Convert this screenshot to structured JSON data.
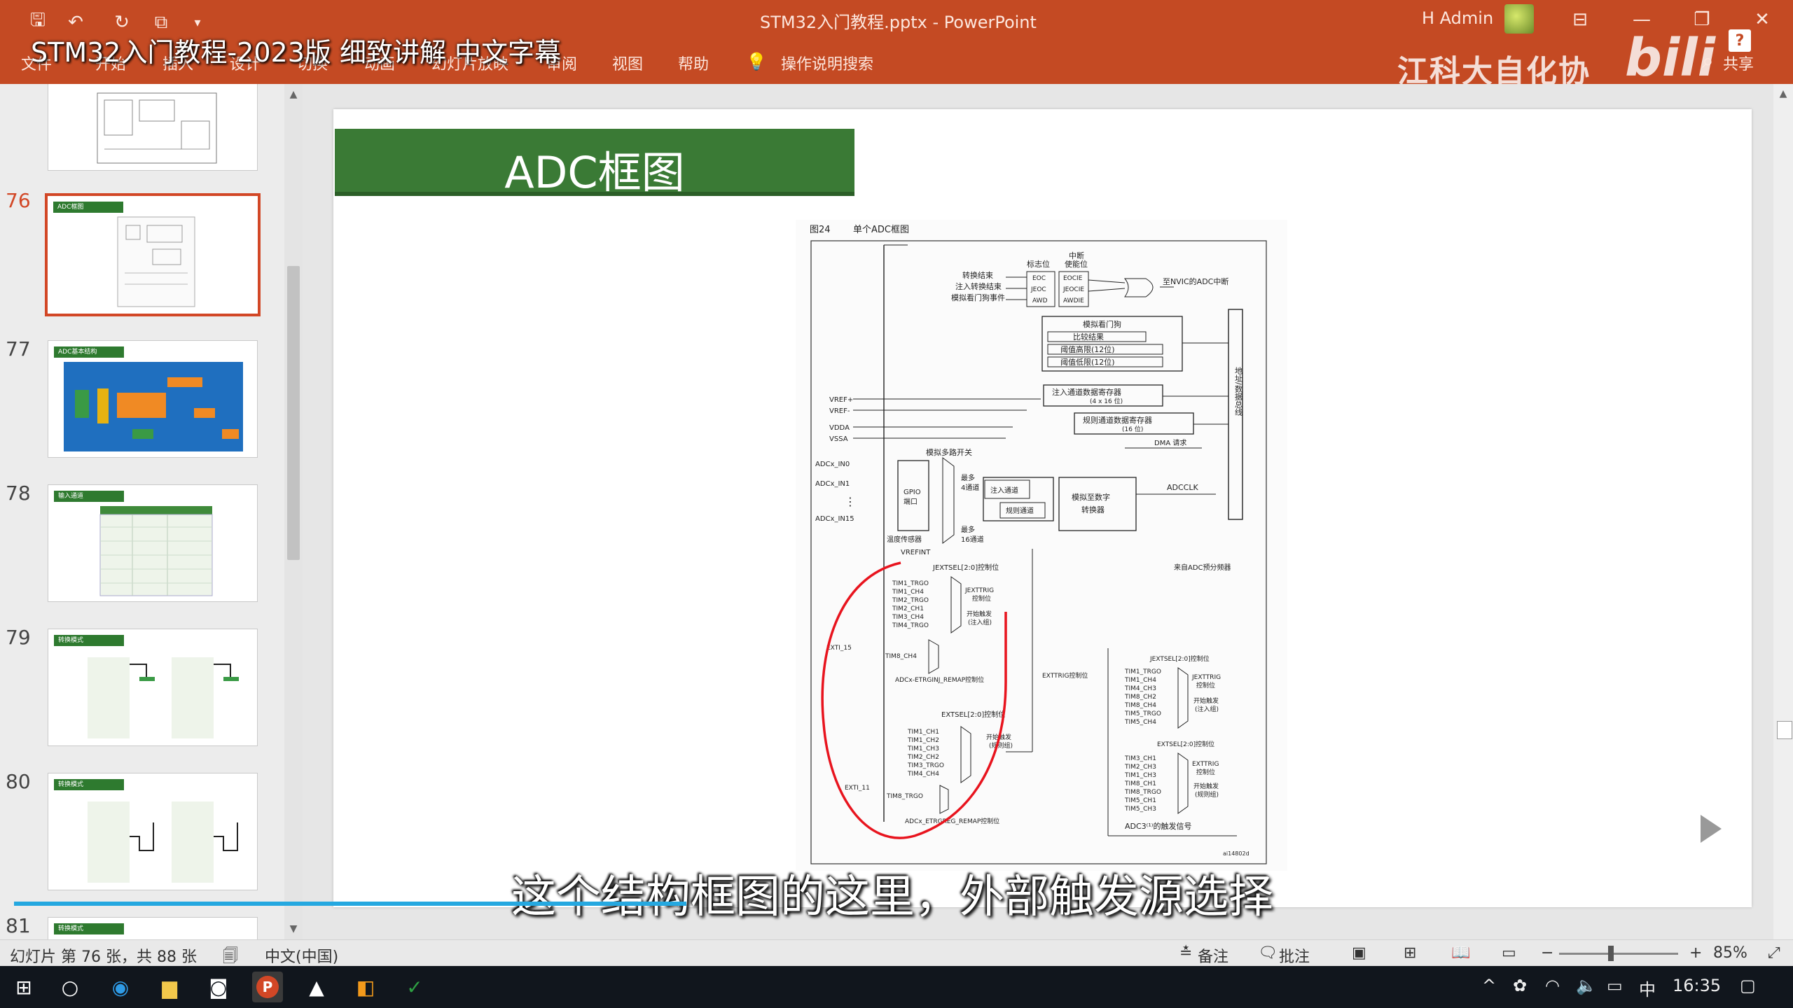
{
  "window": {
    "title": "STM32入门教程.pptx  -  PowerPoint",
    "user": "H Admin",
    "share_label": "共享"
  },
  "overlay_title": "STM32入门教程-2023版 细致讲解 中文字幕",
  "ribbon_tabs": [
    "文件",
    "开始",
    "插入",
    "设计",
    "切换",
    "动画",
    "幻灯片放映",
    "审阅",
    "视图",
    "帮助"
  ],
  "tell_me": "操作说明搜索",
  "watermark": {
    "text": "江科大自化协",
    "logo": "bilibili"
  },
  "thumbnails": [
    {
      "num": "",
      "title": ""
    },
    {
      "num": "76",
      "title": "ADC框图",
      "selected": true
    },
    {
      "num": "77",
      "title": "ADC基本结构"
    },
    {
      "num": "78",
      "title": "输入通道"
    },
    {
      "num": "79",
      "title": "转换模式"
    },
    {
      "num": "80",
      "title": "转换模式"
    },
    {
      "num": "81",
      "title": "转换模式"
    }
  ],
  "slide": {
    "title": "ADC框图",
    "figure": {
      "caption_num": "图24",
      "caption": "单个ADC框图",
      "labels": {
        "interrupt": "中断",
        "flag": "标志位",
        "enable": "使能位",
        "eoc_end": "转换结束",
        "jeoc_end": "注入转换结束",
        "awd_event": "模拟看门狗事件",
        "eoc": "EOC",
        "jeoc": "JEOC",
        "awd": "AWD",
        "eocie": "EOCIE",
        "jeocie": "JEOCIE",
        "awdie": "AWDIE",
        "nvic": "至NVIC的ADC中断",
        "watchdog": "模拟看门狗",
        "compare": "比较结果",
        "high_th": "阈值高限(12位)",
        "low_th": "阈值低限(12位)",
        "inj_reg": "注入通道数据寄存器",
        "inj_reg_size": "(4 x 16 位)",
        "reg_reg": "规则通道数据寄存器",
        "reg_reg_size": "(16 位)",
        "dma": "DMA 请求",
        "bus": "地址/数据总线",
        "vrefp": "VREF+",
        "vrefn": "VREF-",
        "vdda": "VDDA",
        "vssa": "VSSA",
        "mux": "模拟多路开关",
        "in0": "ADCx_IN0",
        "in1": "ADCx_IN1",
        "in15": "ADCx_IN15",
        "gpio": "GPIO",
        "port": "端口",
        "up4": "最多",
        "ch4": "4通道",
        "up16": "最多",
        "ch16": "16通道",
        "inj_ch": "注入通道",
        "reg_ch": "规则通道",
        "adc_conv": "模拟至数字",
        "adc_conv2": "转换器",
        "adcclk": "ADCCLK",
        "temp": "温度传感器",
        "vrefint": "VREFINT",
        "prescaler": "来自ADC预分频器",
        "jextsel": "JEXTSEL[2:0]控制位",
        "t1_trgo": "TIM1_TRGO",
        "t1_ch4": "TIM1_CH4",
        "t2_trgo": "TIM2_TRGO",
        "t2_ch1": "TIM2_CH1",
        "t3_ch4": "TIM3_CH4",
        "t4_trgo": "TIM4_TRGO",
        "jexttrig": "JEXTTRIG",
        "jexttrig2": "控制位",
        "start_inj": "开始触发",
        "start_inj2": "(注入组)",
        "exti15": "EXTI_15",
        "t8_ch4": "TIM8_CH4",
        "inj_remap": "ADCx-ETRGINJ_REMAP控制位",
        "exttrig": "EXTTRIG控制位",
        "extsel": "EXTSEL[2:0]控制位",
        "r_t1_ch1": "TIM1_CH1",
        "r_t1_ch2": "TIM1_CH2",
        "r_t1_ch3": "TIM1_CH3",
        "r_t2_ch2": "TIM2_CH2",
        "r_t3_trgo": "TIM3_TRGO",
        "r_t4_ch4": "TIM4_CH4",
        "start_reg": "开始触发",
        "start_reg2": "(规则组)",
        "exti11": "EXTI_11",
        "t8_trgo": "TIM8_TRGO",
        "reg_remap": "ADCx_ETRGREG_REMAP控制位",
        "adc3_jextsel": "JEXTSEL[2:0]控制位",
        "a3_1": "TIM1_TRGO",
        "a3_2": "TIM1_CH4",
        "a3_3": "TIM4_CH3",
        "a3_4": "TIM8_CH2",
        "a3_5": "TIM8_CH4",
        "a3_6": "TIM5_TRGO",
        "a3_7": "TIM5_CH4",
        "a3_jexttrig": "JEXTTRIG",
        "a3_ctrl": "控制位",
        "a3_start": "开始触发",
        "a3_inj": "(注入组)",
        "adc3_extsel": "EXTSEL[2:0]控制位",
        "b3_1": "TIM3_CH1",
        "b3_2": "TIM2_CH3",
        "b3_3": "TIM1_CH3",
        "b3_4": "TIM8_CH1",
        "b3_5": "TIM8_TRGO",
        "b3_6": "TIM5_CH1",
        "b3_7": "TIM5_CH3",
        "b3_exttrig": "EXTTRIG",
        "b3_ctrl": "控制位",
        "b3_start": "开始触发",
        "b3_reg": "(规则组)",
        "adc3_note": "ADC3⁽¹⁾的触发信号",
        "fig_id": "ai14802d"
      }
    }
  },
  "subtitle": "这个结构框图的这里，外部触发源选择",
  "statusbar": {
    "slide_info": "幻灯片 第 76 张，共 88 张",
    "language": "中文(中国)",
    "notes": "备注",
    "comments": "批注",
    "zoom": "85%"
  },
  "taskbar": {
    "time": "16:35",
    "ime": "中"
  },
  "colors": {
    "ribbon": "#c44a23",
    "banner": "#3a7a35",
    "selection": "#d24726",
    "annotation": "#e8141e"
  }
}
